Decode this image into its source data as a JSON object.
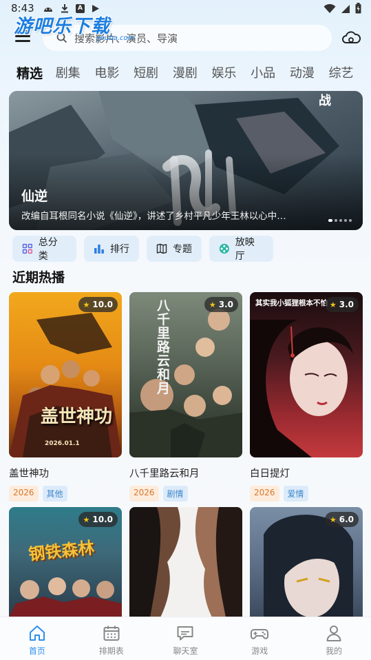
{
  "status_bar": {
    "time": "8:43",
    "badge_letter": "A"
  },
  "watermark": {
    "text": "游吧乐下载",
    "sub": "youba.com"
  },
  "search": {
    "placeholder": "搜索影片、演员、导演"
  },
  "tabs": [
    "精选",
    "剧集",
    "电影",
    "短剧",
    "漫剧",
    "娱乐",
    "小品",
    "动漫",
    "综艺"
  ],
  "active_tab": "精选",
  "banner": {
    "title": "仙逆",
    "corner_text": "战",
    "description": "改编自耳根同名小说《仙逆》，讲述了乡村平凡少年王林以心中…",
    "art_text": "仙"
  },
  "quick_actions": [
    {
      "label": "总分类",
      "icon": "grid-icon"
    },
    {
      "label": "排行",
      "icon": "bar-chart-icon"
    },
    {
      "label": "专题",
      "icon": "book-icon"
    },
    {
      "label": "放映厅",
      "icon": "film-reel-icon"
    }
  ],
  "section": {
    "title": "近期热播"
  },
  "cards": [
    {
      "title": "盖世神功",
      "rating": "10.0",
      "year": "2026",
      "genre": "其他",
      "poster_text": "盖世神功",
      "poster_date": "2026.01.1"
    },
    {
      "title": "八千里路云和月",
      "rating": "3.0",
      "year": "2026",
      "genre": "剧情",
      "poster_text": "八千里路云和月"
    },
    {
      "title": "白日提灯",
      "rating": "3.0",
      "year": "2026",
      "genre": "爱情",
      "poster_text": "其实我小狐狸根本不怕"
    },
    {
      "rating": "10.0",
      "poster_text": "钢铁森林"
    },
    {
      "poster_text": ""
    },
    {
      "rating": "6.0"
    }
  ],
  "bottom_nav": [
    {
      "label": "首页",
      "icon": "home-icon",
      "active": true
    },
    {
      "label": "排期表",
      "icon": "calendar-icon",
      "active": false
    },
    {
      "label": "聊天室",
      "icon": "chat-icon",
      "active": false
    },
    {
      "label": "游戏",
      "icon": "gamepad-icon",
      "active": false
    },
    {
      "label": "我的",
      "icon": "user-icon",
      "active": false
    }
  ],
  "colors": {
    "accent": "#2c8ff0",
    "year_tag": "#d7772f",
    "genre_tag": "#3f86c9"
  }
}
